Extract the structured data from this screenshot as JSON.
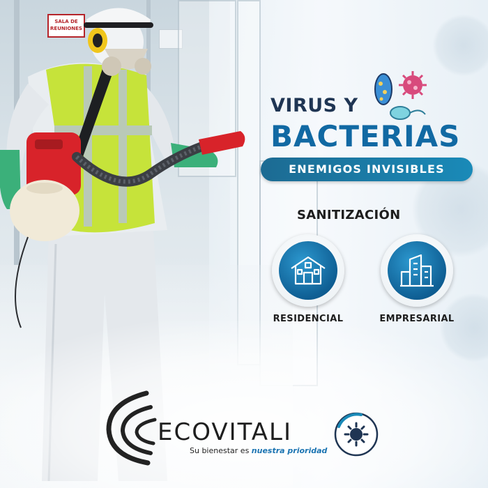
{
  "scene": {
    "room_sign": "SALA DE REUNIONES"
  },
  "headline": {
    "line1": "VIRUS Y",
    "line2": "BACTERIAS",
    "banner": "ENEMIGOS INVISIBLES"
  },
  "section_title": "SANITIZACIÓN",
  "services": [
    {
      "label": "RESIDENCIAL",
      "icon": "house-icon"
    },
    {
      "label": "EMPRESARIAL",
      "icon": "buildings-icon"
    }
  ],
  "brand": {
    "name": "ECOVITALI",
    "tagline_prefix": "Su bienestar es ",
    "tagline_highlight": "nuestra prioridad"
  },
  "colors": {
    "navy": "#1f3553",
    "accent_blue": "#1169a3",
    "banner": "#1a7fb0",
    "vest": "#c6e33a",
    "sprayer": "#d8232a",
    "gloves": "#3bb07a"
  }
}
